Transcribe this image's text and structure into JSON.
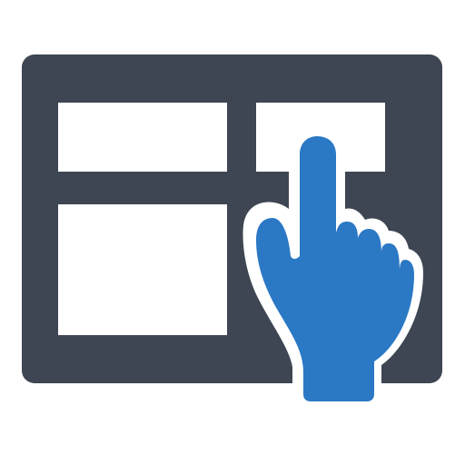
{
  "icon": {
    "name": "layout-touch-icon",
    "colors": {
      "panel": "#3d4652",
      "hand": "#2b78c5",
      "background": "#ffffff",
      "tiles": "#ffffff",
      "hand_outline": "#ffffff"
    }
  }
}
